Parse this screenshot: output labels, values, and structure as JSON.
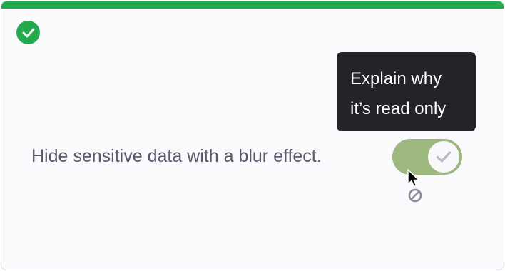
{
  "card": {
    "accent_color": "#22ab4c",
    "status_icon": "check-circle-icon"
  },
  "tooltip": {
    "line1": "Explain why",
    "line2": "it’s read only"
  },
  "setting": {
    "label": "Hide sensitive data with a blur effect.",
    "toggle_state": "on",
    "read_only": true,
    "toggle_color": "#9cb87f",
    "knob_icon": "check-icon"
  },
  "cursor": {
    "pointer_icon": "arrow-cursor-icon",
    "badge_icon": "not-allowed-icon"
  }
}
